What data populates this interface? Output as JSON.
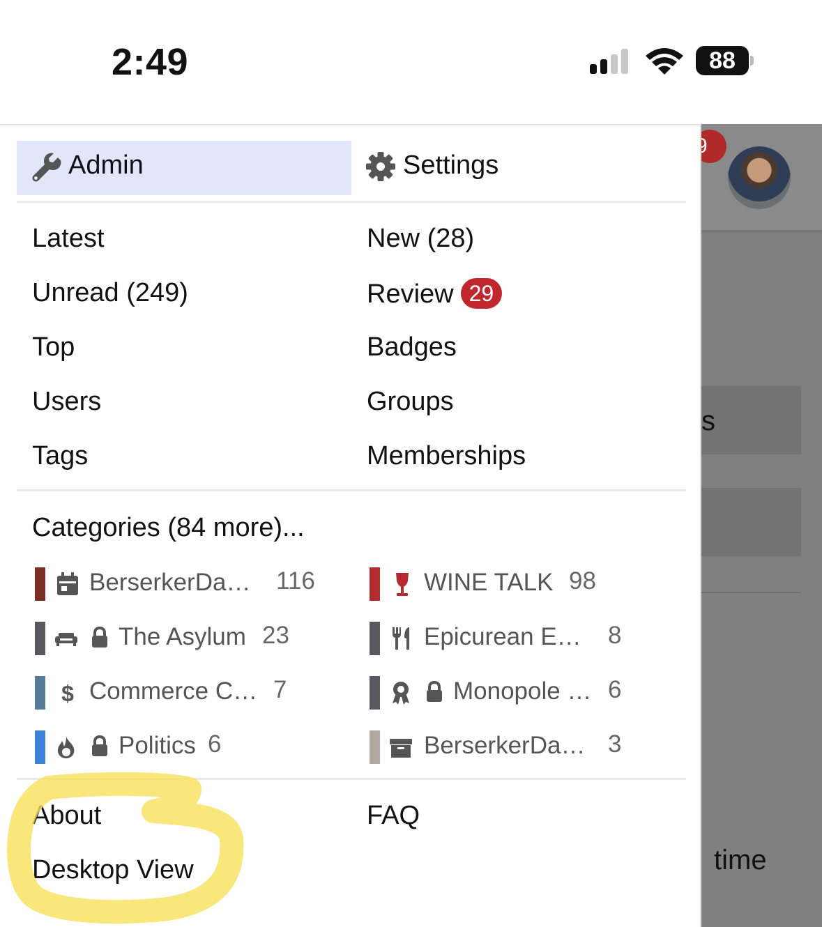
{
  "status_bar": {
    "time": "2:49",
    "battery": "88"
  },
  "menu": {
    "admin_label": "Admin",
    "settings_label": "Settings",
    "nav_left": [
      "Latest",
      "Unread (249)",
      "Top",
      "Users",
      "Tags"
    ],
    "nav_right": [
      "New (28)",
      "Review",
      "Badges",
      "Groups",
      "Memberships"
    ],
    "review_count": "29",
    "categories_heading": "Categories (84 more)...",
    "categories": [
      {
        "name": "BerserkerDa…",
        "count": "116",
        "color": "#7b2e24",
        "icon": "calendar-icon",
        "locked": false
      },
      {
        "name": "WINE TALK",
        "count": "98",
        "color": "#b32a2f",
        "icon": "wine-glass-icon",
        "locked": false
      },
      {
        "name": "The Asylum",
        "count": "23",
        "color": "#59585e",
        "icon": "couch-icon",
        "locked": true
      },
      {
        "name": "Epicurean E…",
        "count": "8",
        "color": "#59585e",
        "icon": "utensils-icon",
        "locked": false
      },
      {
        "name": "Commerce C…",
        "count": "7",
        "color": "#587b9b",
        "icon": "dollar-icon",
        "locked": false
      },
      {
        "name": "Monopole …",
        "count": "6",
        "color": "#59585e",
        "icon": "award-icon",
        "locked": true
      },
      {
        "name": "Politics",
        "count": "6",
        "color": "#3b82d8",
        "icon": "fire-icon",
        "locked": true
      },
      {
        "name": "BerserkerDa…",
        "count": "3",
        "color": "#b3a89e",
        "icon": "archive-icon",
        "locked": false
      }
    ],
    "footer_left": [
      "About",
      "Desktop View"
    ],
    "footer_right": [
      "FAQ"
    ]
  },
  "background_page": {
    "notification_badge": "9",
    "partial_text_1": "s",
    "partial_text_2": "time"
  },
  "colors": {
    "admin_highlight": "#e1e6fb",
    "badge_red": "#c0272d",
    "marker_yellow": "#f7e15a"
  }
}
